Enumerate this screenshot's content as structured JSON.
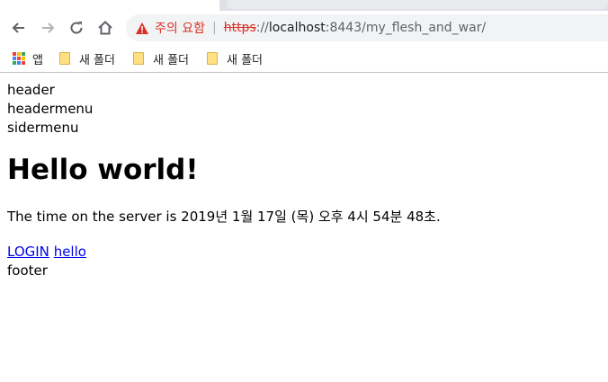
{
  "browser": {
    "security_warning": "주의 요함",
    "url": {
      "scheme": "https",
      "host_sep": "://",
      "host": "localhost",
      "rest": ":8443/my_flesh_and_war/"
    },
    "bookmarks": [
      {
        "label": "앱",
        "icon": "apps-grid-icon"
      },
      {
        "label": "새 폴더",
        "icon": "folder-icon"
      },
      {
        "label": "새 폴더",
        "icon": "folder-icon"
      },
      {
        "label": "새 폴더",
        "icon": "folder-icon"
      }
    ],
    "colors": {
      "warning": "#d93025",
      "link": "#0000ee",
      "folder": "#ffe082"
    }
  },
  "page": {
    "header": "header",
    "headermenu": "headermenu",
    "sidermenu": "sidermenu",
    "title": "Hello world!",
    "time_text": "The time on the server is 2019년 1월 17일 (목) 오후 4시 54분 48초.",
    "links": [
      {
        "label": "LOGIN"
      },
      {
        "label": "hello"
      }
    ],
    "footer": "footer"
  }
}
